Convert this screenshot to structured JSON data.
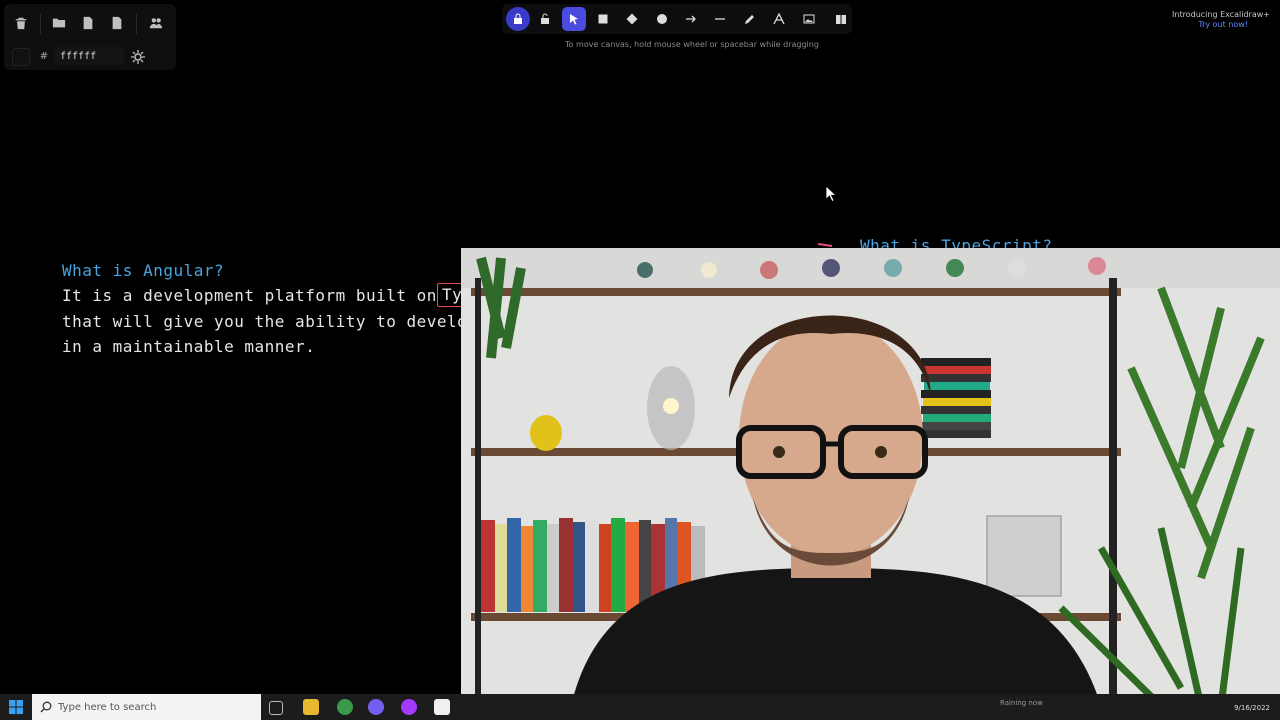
{
  "left_panel": {
    "color_hash": "#",
    "color_value": "ffffff"
  },
  "toolbar": {
    "hint": "To move canvas, hold mouse wheel or spacebar while dragging"
  },
  "promo": {
    "title": "Introducing Excalidraw+",
    "link": "Try out now!"
  },
  "canvas": {
    "heading_angular": "What is Angular?",
    "line1": "It is a development platform built on",
    "highlight": "TypeScript",
    "line2": "that will give you the ability to develop",
    "line3": "in a maintainable manner.",
    "heading_typescript": "What is TypeScript?"
  },
  "taskbar": {
    "search_placeholder": "Type here to search",
    "tray_status": "Raining now",
    "date": "9/16/2022"
  },
  "colors": {
    "accent": "#4a4ce0",
    "heading_blue": "#4aa3df",
    "highlight_red": "#e05050"
  }
}
